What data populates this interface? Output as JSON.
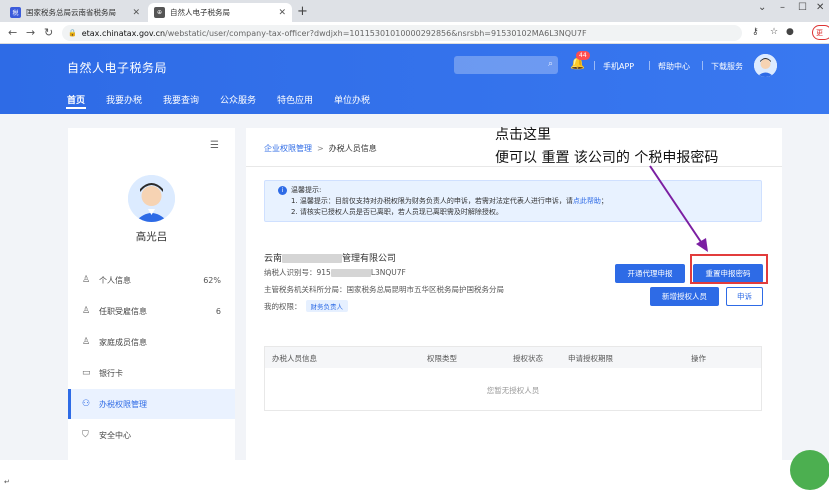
{
  "browser": {
    "tabs": [
      {
        "label": "国家税务总局云南省税务局",
        "favicon": "税",
        "active": false
      },
      {
        "label": "自然人电子税务局",
        "favicon": "⊕",
        "active": true
      }
    ],
    "url_host": "etax.chinatax.gov.cn",
    "url_path": "/webstatic/user/company-tax-officer?dwdjxh=10115301010000292856&nsrsbh=91530102MA6L3NQU7F",
    "profile_label": "更"
  },
  "header": {
    "logo": "自然人电子税务局",
    "notification_count": "44",
    "links": [
      "手机APP",
      "帮助中心",
      "下载服务"
    ],
    "nav": [
      "首页",
      "我要办税",
      "我要查询",
      "公众服务",
      "特色应用",
      "单位办税"
    ]
  },
  "sidebar": {
    "user_name": "高光吕",
    "items": [
      {
        "label": "个人信息",
        "value": "62%",
        "icon": "user-icon"
      },
      {
        "label": "任职受雇信息",
        "value": "6",
        "icon": "employment-icon"
      },
      {
        "label": "家庭成员信息",
        "value": "",
        "icon": "family-icon"
      },
      {
        "label": "银行卡",
        "value": "",
        "icon": "bank-card-icon"
      },
      {
        "label": "办税权限管理",
        "value": "",
        "icon": "org-icon",
        "active": true
      },
      {
        "label": "安全中心",
        "value": "",
        "icon": "shield-icon"
      }
    ]
  },
  "main": {
    "breadcrumb": {
      "parent": "企业权限管理",
      "separator": ">",
      "current": "办税人员信息"
    },
    "tip": {
      "title": "温馨提示:",
      "line1": "1. 温馨提示：目前仅支持对办税权限为财务负责人的申诉，若需对法定代表人进行申诉，请",
      "line1_link": "点此帮助",
      "line1_end": "；",
      "line2": "2. 请核实已授权人员是否已离职，若人员现已离职需及时解除授权。"
    },
    "company": {
      "name_prefix": "云南",
      "name_suffix": "管理有限公司",
      "taxid_label": "纳税人识别号：",
      "taxid_prefix": "915",
      "taxid_suffix": "L3NQU7F",
      "authority": "主管税务机关科所分局：国家税务总局昆明市五华区税务局护国税务分局",
      "role_label": "我的权限：",
      "role": "财务负责人"
    },
    "buttons": {
      "open_agent": "开通代理申报",
      "reset_password": "重置申报密码",
      "add_person": "新增授权人员",
      "appeal": "申诉"
    },
    "table": {
      "columns": [
        "办税人员信息",
        "权限类型",
        "授权状态",
        "申请授权期限",
        "操作"
      ],
      "empty_text": "您暂无授权人员"
    }
  },
  "annotation": {
    "line1": "点击这里",
    "line2": "便可以  重置 该公司的  个税申报密码"
  },
  "colors": {
    "brand": "#2e6be6",
    "highlight": "#e23c3c",
    "arrow": "#7b1fa2"
  }
}
